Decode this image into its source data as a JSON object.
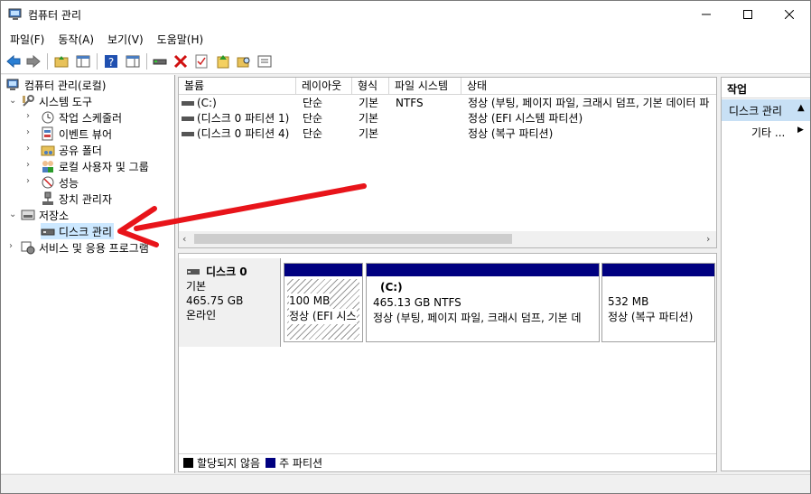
{
  "window": {
    "title": "컴퓨터 관리"
  },
  "menu": [
    "파일(F)",
    "동작(A)",
    "보기(V)",
    "도움말(H)"
  ],
  "tree": {
    "root": "컴퓨터 관리(로컬)",
    "system_tools": "시스템 도구",
    "task_scheduler": "작업 스케줄러",
    "event_viewer": "이벤트 뷰어",
    "shared_folders": "공유 폴더",
    "local_users": "로컬 사용자 및 그룹",
    "performance": "성능",
    "device_manager": "장치 관리자",
    "storage": "저장소",
    "disk_management": "디스크 관리",
    "services": "서비스 및 응용 프로그램"
  },
  "volumes": {
    "columns": [
      "볼륨",
      "레이아웃",
      "형식",
      "파일 시스템",
      "상태"
    ],
    "rows": [
      {
        "volume": "(C:)",
        "layout": "단순",
        "type": "기본",
        "fs": "NTFS",
        "status": "정상 (부팅, 페이지 파일, 크래시 덤프, 기본 데이터 파"
      },
      {
        "volume": "(디스크 0 파티션 1)",
        "layout": "단순",
        "type": "기본",
        "fs": "",
        "status": "정상 (EFI 시스템 파티션)"
      },
      {
        "volume": "(디스크 0 파티션 4)",
        "layout": "단순",
        "type": "기본",
        "fs": "",
        "status": "정상 (복구 파티션)"
      }
    ]
  },
  "disk": {
    "name": "디스크 0",
    "type": "기본",
    "size": "465.75 GB",
    "state": "온라인",
    "partitions": [
      {
        "label": "",
        "size": "100 MB",
        "status": "정상 (EFI 시스"
      },
      {
        "label": "(C:)",
        "size": "465.13 GB NTFS",
        "status": "정상 (부팅, 페이지 파일, 크래시 덤프, 기본 데"
      },
      {
        "label": "",
        "size": "532 MB",
        "status": "정상 (복구 파티션)"
      }
    ]
  },
  "legend": {
    "unallocated": "할당되지 않음",
    "primary": "주 파티션"
  },
  "actions": {
    "title": "작업",
    "section": "디스크 관리",
    "more": "기타 ..."
  },
  "colors": {
    "primary_partition": "#000080",
    "selection": "#cce8ff",
    "arrow": "#e8141a"
  }
}
